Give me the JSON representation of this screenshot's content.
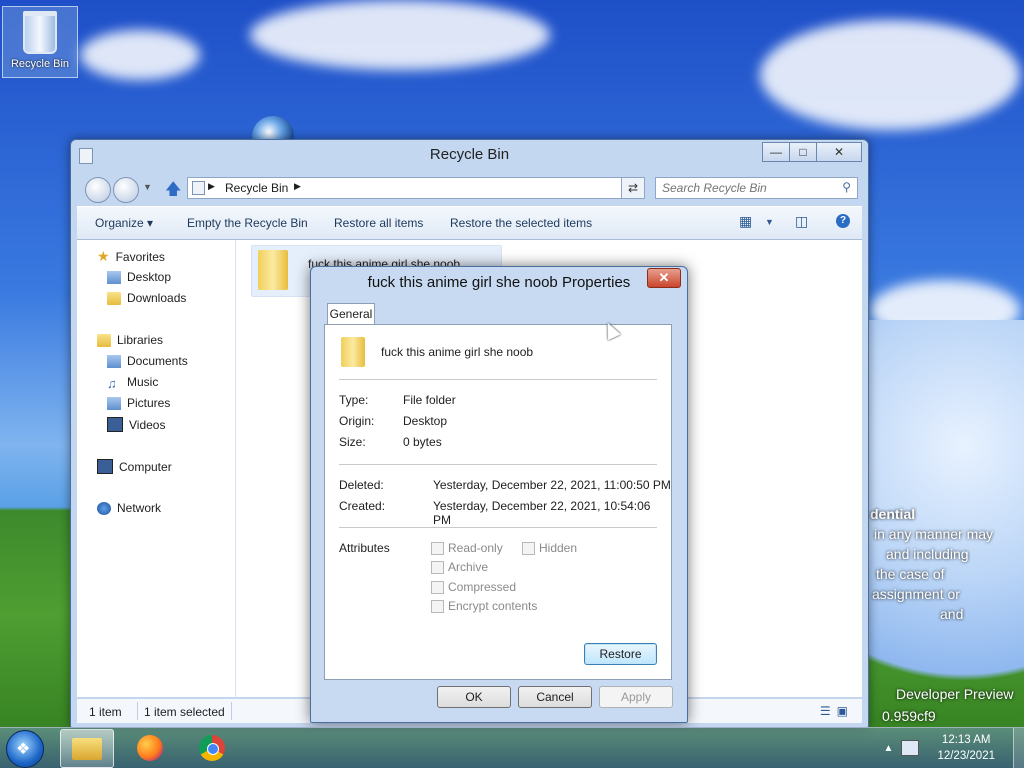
{
  "desktop": {
    "recycle_bin_label": "Recycle Bin",
    "background_text": {
      "line1": "dential",
      "line2": "in any manner may",
      "line3": "and including",
      "line4": "the case of",
      "line5": "assignment or",
      "line6": "and",
      "line7": "Developer Preview",
      "line8": "0.959cf9"
    }
  },
  "explorer": {
    "title": "Recycle Bin",
    "address": {
      "crumb": "Recycle Bin"
    },
    "search": {
      "placeholder": "Search Recycle Bin"
    },
    "toolbar": {
      "organize": "Organize ▾",
      "empty": "Empty the Recycle Bin",
      "restore_all": "Restore all items",
      "restore_selected": "Restore the selected items"
    },
    "nav": {
      "favorites": "Favorites",
      "desktop": "Desktop",
      "downloads": "Downloads",
      "libraries": "Libraries",
      "documents": "Documents",
      "music": "Music",
      "pictures": "Pictures",
      "videos": "Videos",
      "computer": "Computer",
      "network": "Network"
    },
    "items": [
      {
        "name": "fuck this anime girl she noob"
      }
    ],
    "status": {
      "count": "1 item",
      "selected": "1 item selected"
    }
  },
  "dialog": {
    "title": "fuck this anime girl she noob Properties",
    "tab": "General",
    "name": "fuck this anime girl she noob",
    "type_label": "Type:",
    "type_value": "File folder",
    "origin_label": "Origin:",
    "origin_value": "Desktop",
    "size_label": "Size:",
    "size_value": "0 bytes",
    "deleted_label": "Deleted:",
    "deleted_value": "Yesterday, December 22, 2021, 11:00:50 PM",
    "created_label": "Created:",
    "created_value": "Yesterday, December 22, 2021, 10:54:06 PM",
    "attributes_label": "Attributes",
    "attrs": {
      "read_only": "Read-only",
      "hidden": "Hidden",
      "archive": "Archive",
      "compressed": "Compressed",
      "encrypt": "Encrypt contents"
    },
    "restore": "Restore",
    "ok": "OK",
    "cancel": "Cancel",
    "apply": "Apply"
  },
  "taskbar": {
    "time": "12:13 AM",
    "date": "12/23/2021"
  }
}
